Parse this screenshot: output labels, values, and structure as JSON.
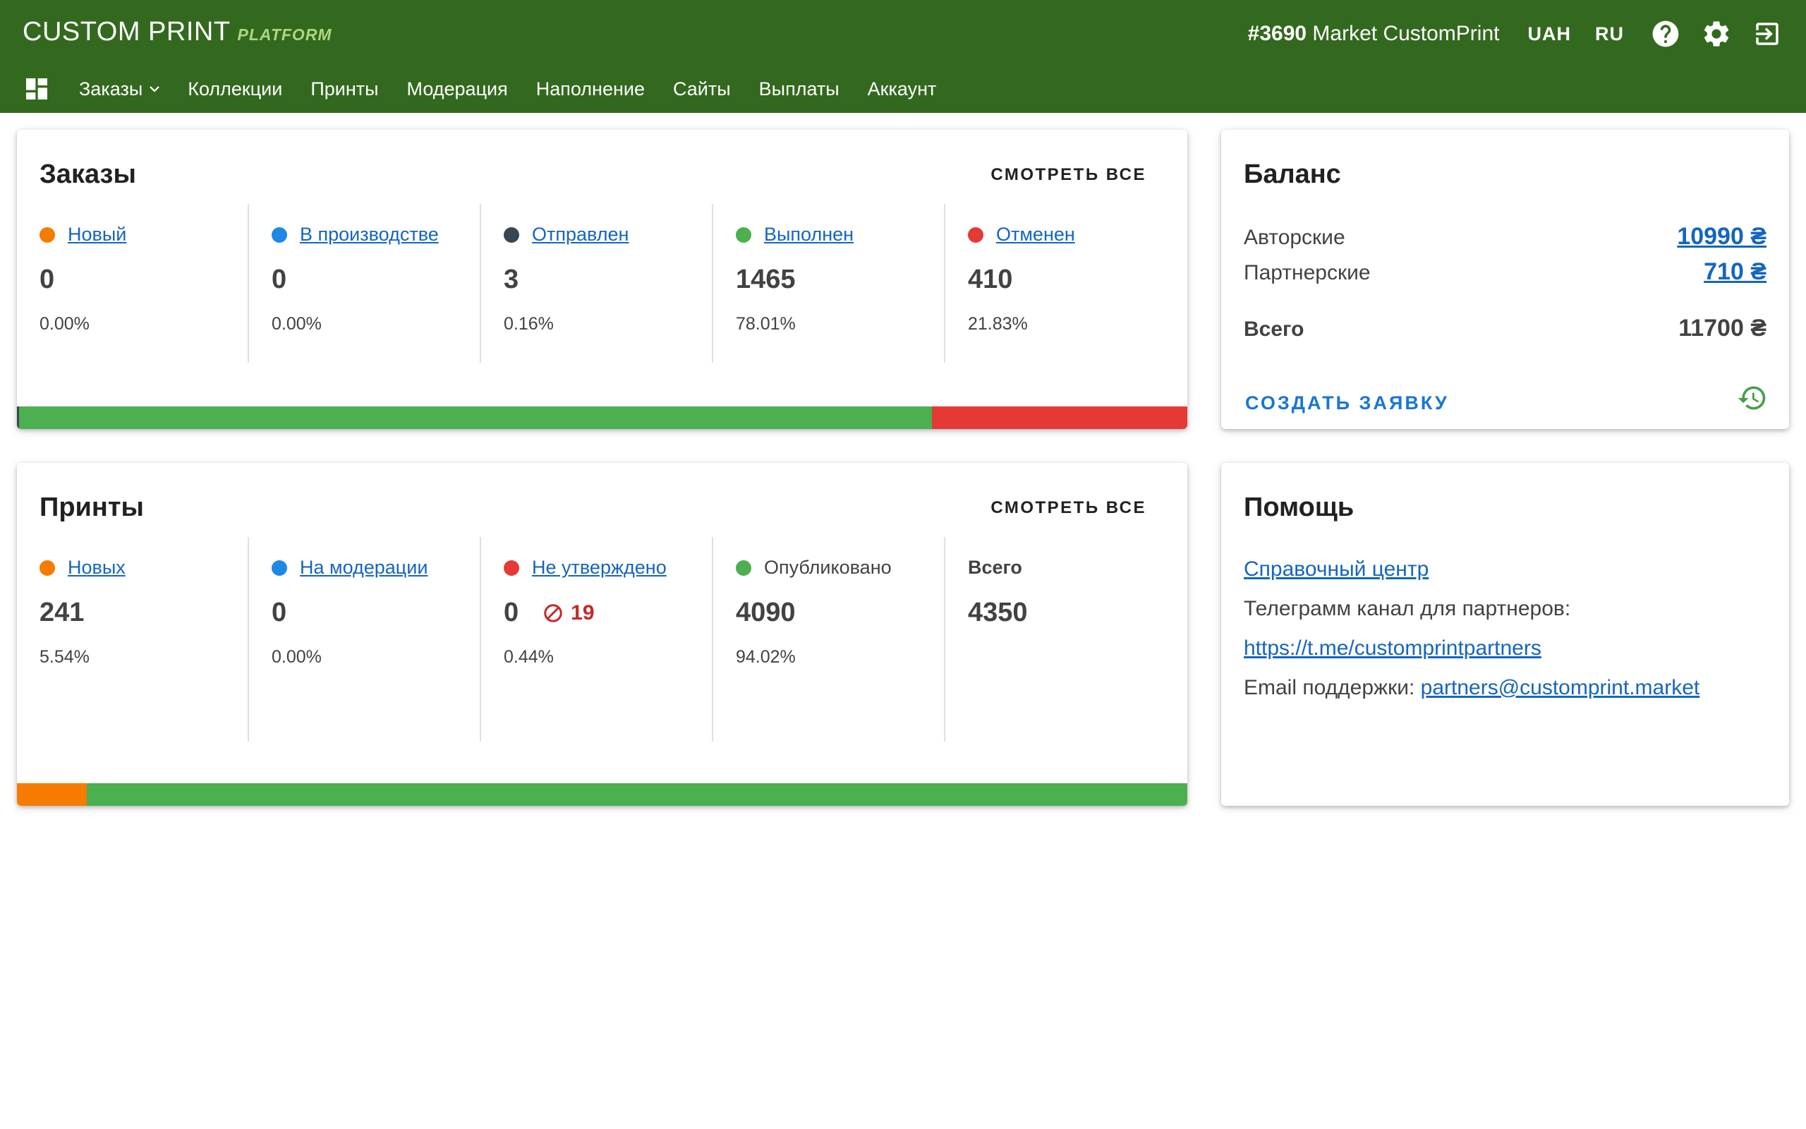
{
  "header": {
    "brand": "CUSTOM PRINT",
    "brand_sub": "PLATFORM",
    "shop_id": "#3690",
    "shop_name": "Market CustomPrint",
    "currency": "UAH",
    "language": "RU",
    "icons": [
      "help-icon",
      "gear-icon",
      "logout-icon"
    ]
  },
  "nav": {
    "items": [
      {
        "label": "Заказы",
        "dropdown": true
      },
      {
        "label": "Коллекции"
      },
      {
        "label": "Принты"
      },
      {
        "label": "Модерация"
      },
      {
        "label": "Наполнение"
      },
      {
        "label": "Сайты"
      },
      {
        "label": "Выплаты"
      },
      {
        "label": "Аккаунт"
      }
    ]
  },
  "orders": {
    "title": "Заказы",
    "see_all": "СМОТРЕТЬ ВСЕ",
    "stats": [
      {
        "label": "Новый",
        "value": "0",
        "pct": "0.00%",
        "color": "#f57c00"
      },
      {
        "label": "В производстве",
        "value": "0",
        "pct": "0.00%",
        "color": "#1e88e5"
      },
      {
        "label": "Отправлен",
        "value": "3",
        "pct": "0.16%",
        "color": "#37474f"
      },
      {
        "label": "Выполнен",
        "value": "1465",
        "pct": "78.01%",
        "color": "#4caf50"
      },
      {
        "label": "Отменен",
        "value": "410",
        "pct": "21.83%",
        "color": "#e53935"
      }
    ],
    "bar_segments": [
      {
        "fraction": 0.0016,
        "color": "#37474f"
      },
      {
        "fraction": 0.7801,
        "color": "#4caf50"
      },
      {
        "fraction": 0.2183,
        "color": "#e53935"
      }
    ]
  },
  "prints": {
    "title": "Принты",
    "see_all": "СМОТРЕТЬ ВСЕ",
    "stats": [
      {
        "label": "Новых",
        "value": "241",
        "pct": "5.54%",
        "color": "#f57c00"
      },
      {
        "label": "На модерации",
        "value": "0",
        "pct": "0.00%",
        "color": "#1e88e5"
      },
      {
        "label": "Не утверждено",
        "value": "0",
        "pct": "0.44%",
        "color": "#e53935",
        "rejected": "19"
      },
      {
        "label": "Опубликовано",
        "value": "4090",
        "pct": "94.02%",
        "color": "#4caf50"
      },
      {
        "label": "Всего",
        "value": "4350"
      }
    ],
    "bar_segments": [
      {
        "fraction": 0.0596,
        "color": "#f57c00"
      },
      {
        "fraction": 0.9404,
        "color": "#4caf50"
      }
    ]
  },
  "balance": {
    "title": "Баланс",
    "author_label": "Авторские",
    "author_value": "10990 ₴",
    "partner_label": "Партнерские",
    "partner_value": "710 ₴",
    "total_label": "Всего",
    "total_value": "11700 ₴",
    "create_request": "СОЗДАТЬ ЗАЯВКУ"
  },
  "help": {
    "title": "Помощь",
    "help_center": "Справочный центр",
    "telegram_label": "Телеграмм канал для партнеров:",
    "telegram_link": "https://t.me/customprintpartners",
    "email_label": "Email поддержки:",
    "email": "partners@customprint.market"
  },
  "colors": {
    "header_bg": "#33691e",
    "link": "#1565c0",
    "accent_green": "#4caf50",
    "accent_red": "#e53935",
    "accent_orange": "#f57c00"
  }
}
